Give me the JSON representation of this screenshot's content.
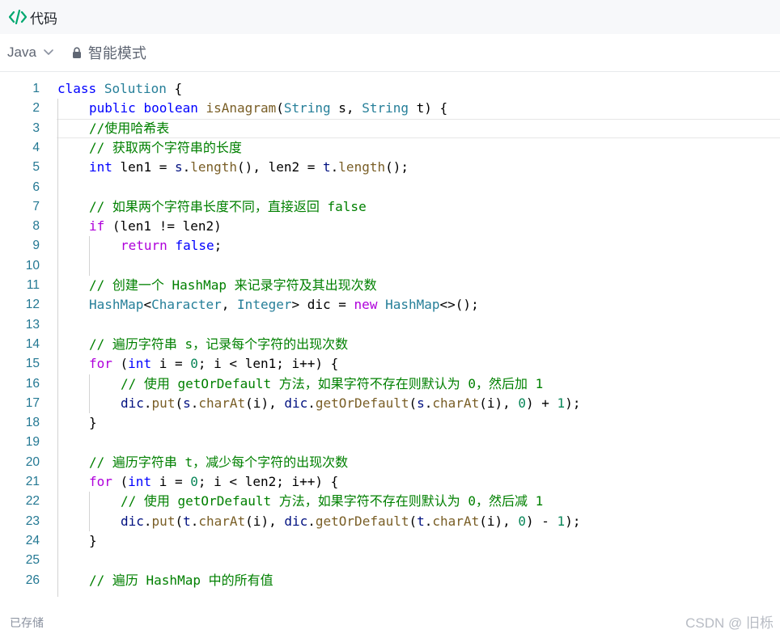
{
  "header": {
    "title": "代码",
    "icon": "code-icon"
  },
  "toolbar": {
    "language": "Java",
    "mode": "智能模式"
  },
  "editor": {
    "active_line": 3,
    "lines": [
      {
        "n": "1",
        "indent": 0,
        "tokens": [
          [
            "kw",
            "class"
          ],
          [
            "op",
            " "
          ],
          [
            "type",
            "Solution"
          ],
          [
            "op",
            " {"
          ]
        ]
      },
      {
        "n": "2",
        "indent": 1,
        "tokens": [
          [
            "kw",
            "public"
          ],
          [
            "op",
            " "
          ],
          [
            "kw",
            "boolean"
          ],
          [
            "op",
            " "
          ],
          [
            "fn",
            "isAnagram"
          ],
          [
            "op",
            "("
          ],
          [
            "type",
            "String"
          ],
          [
            "op",
            " s, "
          ],
          [
            "type",
            "String"
          ],
          [
            "op",
            " t) {"
          ]
        ]
      },
      {
        "n": "3",
        "indent": 1,
        "tokens": [
          [
            "com",
            "//使用哈希表"
          ]
        ]
      },
      {
        "n": "4",
        "indent": 1,
        "tokens": [
          [
            "com",
            "// 获取两个字符串的长度"
          ]
        ]
      },
      {
        "n": "5",
        "indent": 1,
        "tokens": [
          [
            "kw",
            "int"
          ],
          [
            "op",
            " len1 = "
          ],
          [
            "var",
            "s"
          ],
          [
            "op",
            "."
          ],
          [
            "fn",
            "length"
          ],
          [
            "op",
            "(), len2 = "
          ],
          [
            "var",
            "t"
          ],
          [
            "op",
            "."
          ],
          [
            "fn",
            "length"
          ],
          [
            "op",
            "();"
          ]
        ]
      },
      {
        "n": "6",
        "indent": 0,
        "tokens": []
      },
      {
        "n": "7",
        "indent": 1,
        "tokens": [
          [
            "com",
            "// 如果两个字符串长度不同，直接返回 false"
          ]
        ]
      },
      {
        "n": "8",
        "indent": 1,
        "tokens": [
          [
            "ctrl",
            "if"
          ],
          [
            "op",
            " (len1 != len2)"
          ]
        ]
      },
      {
        "n": "9",
        "indent": 2,
        "tokens": [
          [
            "ctrl",
            "return"
          ],
          [
            "op",
            " "
          ],
          [
            "kw",
            "false"
          ],
          [
            "op",
            ";"
          ]
        ]
      },
      {
        "n": "10",
        "indent": 0,
        "tokens": []
      },
      {
        "n": "11",
        "indent": 1,
        "tokens": [
          [
            "com",
            "// 创建一个 HashMap 来记录字符及其出现次数"
          ]
        ]
      },
      {
        "n": "12",
        "indent": 1,
        "tokens": [
          [
            "type",
            "HashMap"
          ],
          [
            "op",
            "<"
          ],
          [
            "type",
            "Character"
          ],
          [
            "op",
            ", "
          ],
          [
            "type",
            "Integer"
          ],
          [
            "op",
            "> dic = "
          ],
          [
            "ctrl",
            "new"
          ],
          [
            "op",
            " "
          ],
          [
            "type",
            "HashMap"
          ],
          [
            "op",
            "<>();"
          ]
        ]
      },
      {
        "n": "13",
        "indent": 0,
        "tokens": []
      },
      {
        "n": "14",
        "indent": 1,
        "tokens": [
          [
            "com",
            "// 遍历字符串 s，记录每个字符的出现次数"
          ]
        ]
      },
      {
        "n": "15",
        "indent": 1,
        "tokens": [
          [
            "ctrl",
            "for"
          ],
          [
            "op",
            " ("
          ],
          [
            "kw",
            "int"
          ],
          [
            "op",
            " i = "
          ],
          [
            "num",
            "0"
          ],
          [
            "op",
            "; i < len1; i++) {"
          ]
        ]
      },
      {
        "n": "16",
        "indent": 2,
        "tokens": [
          [
            "com",
            "// 使用 getOrDefault 方法，如果字符不存在则默认为 0，然后加 1"
          ]
        ]
      },
      {
        "n": "17",
        "indent": 2,
        "tokens": [
          [
            "var",
            "dic"
          ],
          [
            "op",
            "."
          ],
          [
            "fn",
            "put"
          ],
          [
            "op",
            "("
          ],
          [
            "var",
            "s"
          ],
          [
            "op",
            "."
          ],
          [
            "fn",
            "charAt"
          ],
          [
            "op",
            "(i), "
          ],
          [
            "var",
            "dic"
          ],
          [
            "op",
            "."
          ],
          [
            "fn",
            "getOrDefault"
          ],
          [
            "op",
            "("
          ],
          [
            "var",
            "s"
          ],
          [
            "op",
            "."
          ],
          [
            "fn",
            "charAt"
          ],
          [
            "op",
            "(i), "
          ],
          [
            "num",
            "0"
          ],
          [
            "op",
            ") + "
          ],
          [
            "num",
            "1"
          ],
          [
            "op",
            ");"
          ]
        ]
      },
      {
        "n": "18",
        "indent": 1,
        "tokens": [
          [
            "op",
            "}"
          ]
        ]
      },
      {
        "n": "19",
        "indent": 0,
        "tokens": []
      },
      {
        "n": "20",
        "indent": 1,
        "tokens": [
          [
            "com",
            "// 遍历字符串 t，减少每个字符的出现次数"
          ]
        ]
      },
      {
        "n": "21",
        "indent": 1,
        "tokens": [
          [
            "ctrl",
            "for"
          ],
          [
            "op",
            " ("
          ],
          [
            "kw",
            "int"
          ],
          [
            "op",
            " i = "
          ],
          [
            "num",
            "0"
          ],
          [
            "op",
            "; i < len2; i++) {"
          ]
        ]
      },
      {
        "n": "22",
        "indent": 2,
        "tokens": [
          [
            "com",
            "// 使用 getOrDefault 方法，如果字符不存在则默认为 0，然后减 1"
          ]
        ]
      },
      {
        "n": "23",
        "indent": 2,
        "tokens": [
          [
            "var",
            "dic"
          ],
          [
            "op",
            "."
          ],
          [
            "fn",
            "put"
          ],
          [
            "op",
            "("
          ],
          [
            "var",
            "t"
          ],
          [
            "op",
            "."
          ],
          [
            "fn",
            "charAt"
          ],
          [
            "op",
            "(i), "
          ],
          [
            "var",
            "dic"
          ],
          [
            "op",
            "."
          ],
          [
            "fn",
            "getOrDefault"
          ],
          [
            "op",
            "("
          ],
          [
            "var",
            "t"
          ],
          [
            "op",
            "."
          ],
          [
            "fn",
            "charAt"
          ],
          [
            "op",
            "(i), "
          ],
          [
            "num",
            "0"
          ],
          [
            "op",
            ") - "
          ],
          [
            "num",
            "1"
          ],
          [
            "op",
            ");"
          ]
        ]
      },
      {
        "n": "24",
        "indent": 1,
        "tokens": [
          [
            "op",
            "}"
          ]
        ]
      },
      {
        "n": "25",
        "indent": 0,
        "tokens": []
      },
      {
        "n": "26",
        "indent": 1,
        "tokens": [
          [
            "com",
            "// 遍历 HashMap 中的所有值"
          ]
        ]
      }
    ]
  },
  "footer": {
    "status": "已存储",
    "watermark": "CSDN @ 旧栎"
  },
  "colors": {
    "keyword": "#0000ff",
    "control": "#af00db",
    "type": "#267f99",
    "function": "#795e26",
    "variable": "#001080",
    "comment": "#008000",
    "number": "#098658",
    "line_number": "#237893",
    "code_icon": "#00a870"
  }
}
